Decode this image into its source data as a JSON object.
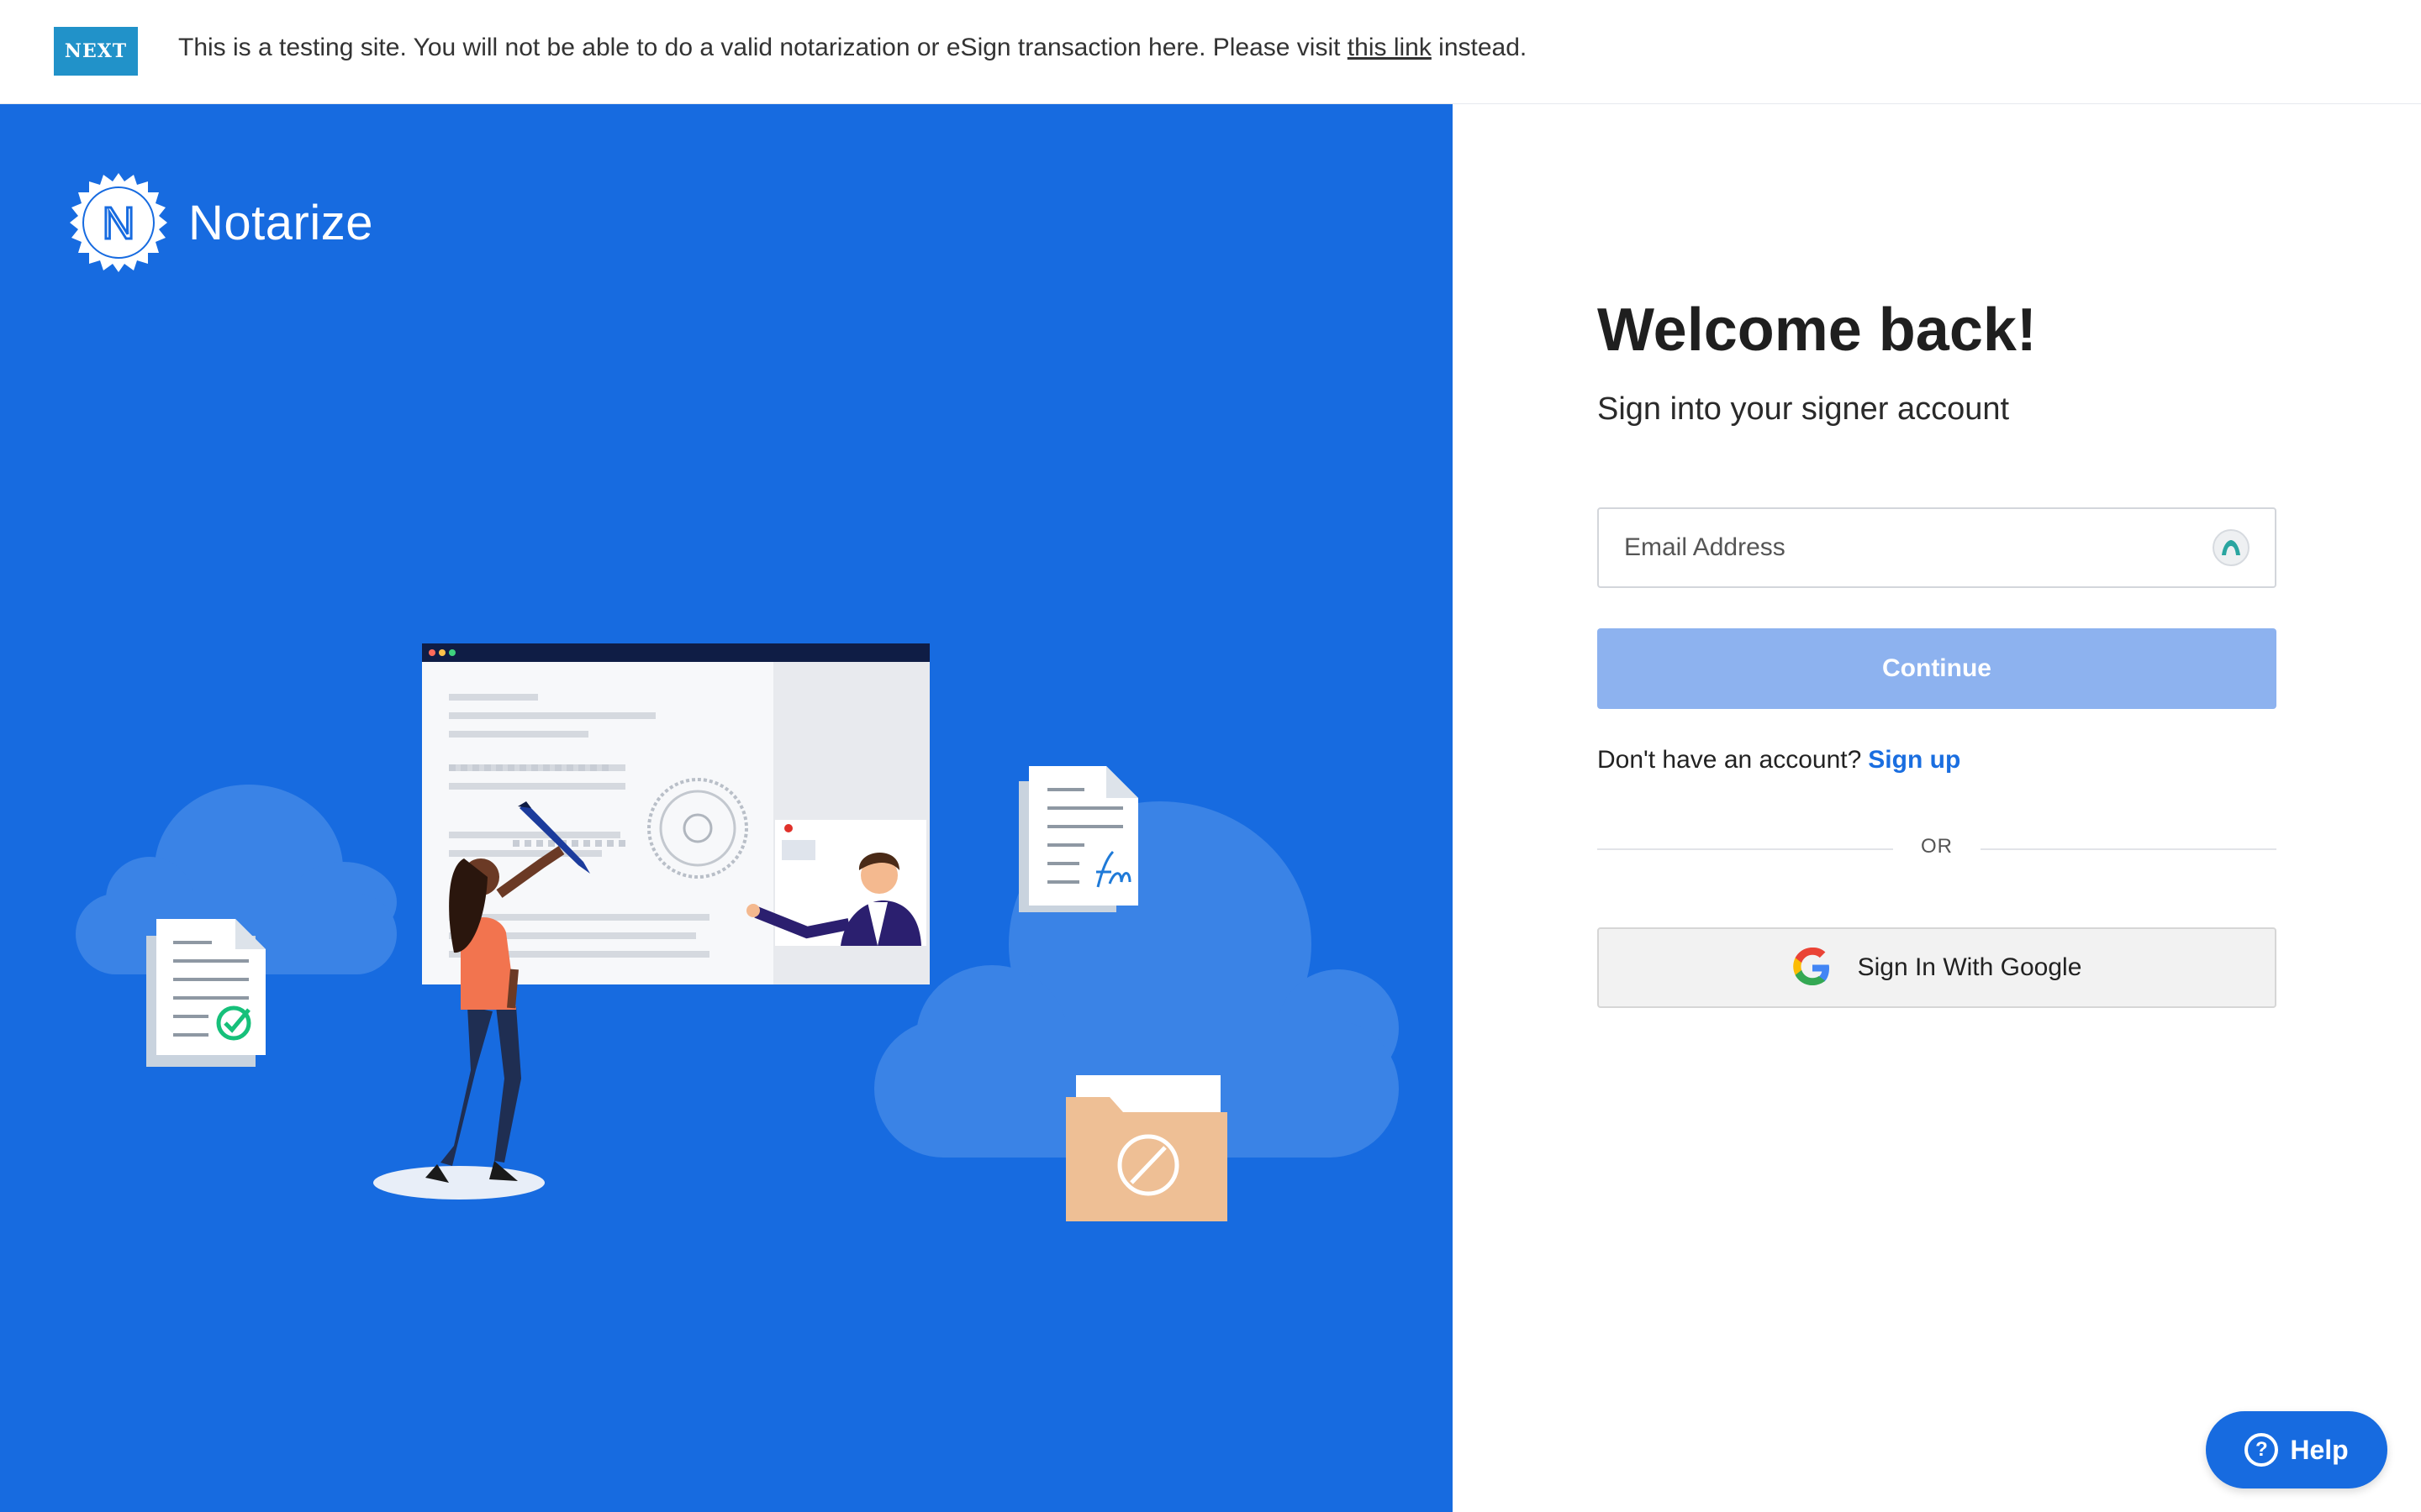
{
  "banner": {
    "badge": "NEXT",
    "message_before": "This is a testing site. You will not be able to do a valid notarization or eSign transaction here. Please visit ",
    "link_text": "this link",
    "message_after": " instead."
  },
  "brand": {
    "name": "Notarize",
    "logo_letter": "N",
    "color": "#176be0"
  },
  "login": {
    "title": "Welcome back!",
    "subtitle": "Sign into your signer account",
    "email_placeholder": "Email Address",
    "email_value": "",
    "continue_label": "Continue",
    "no_account_text": "Don't have an account?",
    "signup_label": "Sign up",
    "or_label": "OR",
    "google_label": "Sign In With Google"
  },
  "help": {
    "label": "Help",
    "icon": "question-circle-icon"
  },
  "colors": {
    "hero_bg": "#176be0",
    "continue_disabled": "#8db2ef",
    "link": "#1a6ee0",
    "badge": "#2192c9"
  }
}
